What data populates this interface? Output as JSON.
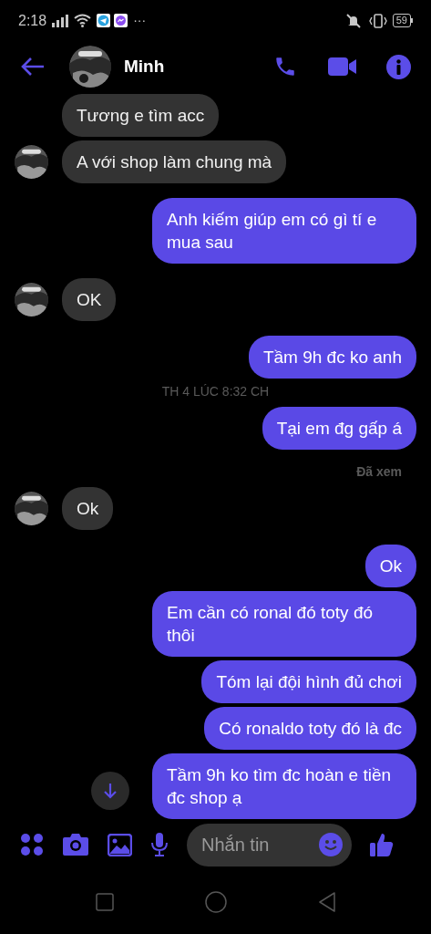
{
  "status_bar": {
    "time": "2:18",
    "more": "···",
    "battery": "59"
  },
  "header": {
    "name": "Minh"
  },
  "messages": [
    {
      "kind": "incoming",
      "text": "Tương e tìm acc",
      "avatar": false
    },
    {
      "kind": "incoming",
      "text": "A với shop làm chung mà",
      "avatar": true
    },
    {
      "kind": "outgoing",
      "text": "Anh kiếm giúp em có gì tí e mua sau"
    },
    {
      "kind": "incoming",
      "text": "OK",
      "avatar": true
    },
    {
      "kind": "outgoing",
      "text": "Tầm 9h đc ko anh"
    },
    {
      "kind": "timestamp",
      "text": "TH 4 LÚC 8:32 CH"
    },
    {
      "kind": "outgoing",
      "text": "Tại em đg gấp á"
    },
    {
      "kind": "seen",
      "text": "Đã xem"
    },
    {
      "kind": "incoming",
      "text": "Ok",
      "avatar": true
    },
    {
      "kind": "outgoing",
      "text": "Ok"
    },
    {
      "kind": "outgoing",
      "text": "Em cần có ronal đó toty đó thôi"
    },
    {
      "kind": "outgoing",
      "text": "Tóm lại đội hình đủ chơi"
    },
    {
      "kind": "outgoing",
      "text": "Có ronaldo toty đó là đc"
    },
    {
      "kind": "outgoing",
      "text": "Tầm 9h ko tìm đc hoàn e tiền đc shop ạ"
    }
  ],
  "composer": {
    "placeholder": "Nhắn tin"
  }
}
